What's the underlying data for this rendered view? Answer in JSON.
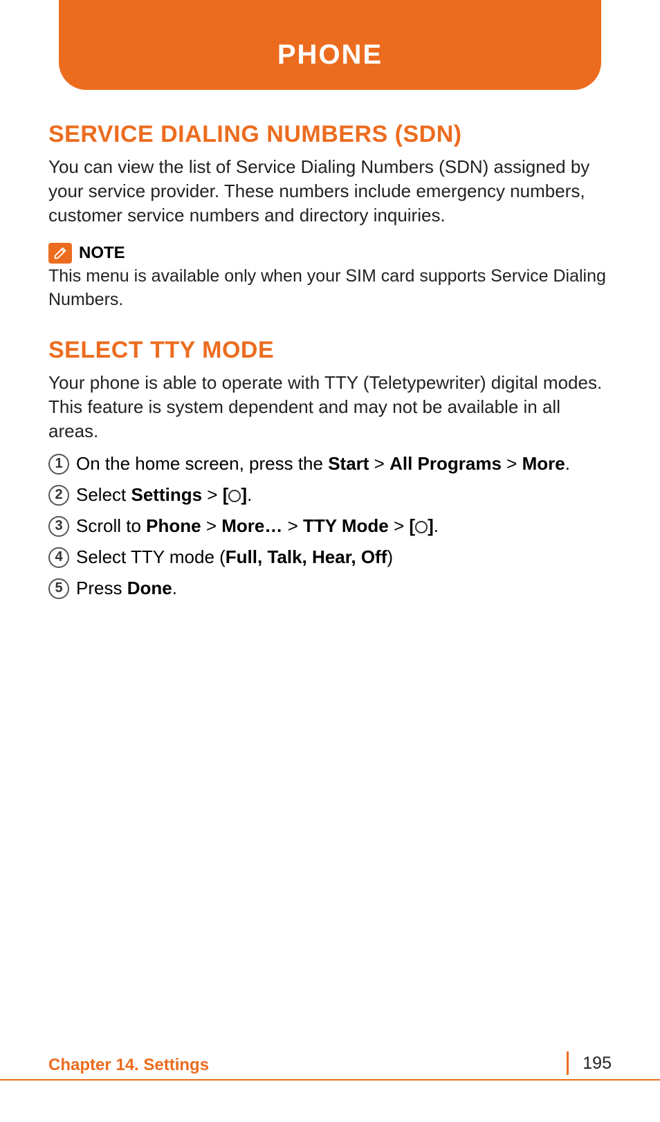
{
  "header": {
    "title": "PHONE"
  },
  "section1": {
    "heading": "SERVICE DIALING NUMBERS (SDN)",
    "body": "You can view the list of Service Dialing Numbers (SDN) assigned by your service provider. These numbers include emergency numbers, customer service numbers and directory inquiries.",
    "note_label": "NOTE",
    "note_text": "This menu is available only when your SIM card supports Service Dialing Numbers."
  },
  "section2": {
    "heading": "SELECT TTY MODE",
    "body": "Your phone is able to operate with TTY (Teletypewriter) digital modes. This feature is system dependent and may not be available in all areas.",
    "steps": [
      {
        "n": "1",
        "pre": "On the home screen, press the ",
        "b1": "Start",
        "gt1": " > ",
        "b2": "All Programs",
        "gt2": " > ",
        "b3": "More",
        "tail": ".",
        "has_circle": false,
        "tail2": ""
      },
      {
        "n": "2",
        "pre": "Select ",
        "b1": "Settings",
        "gt1": " > ",
        "b2": "[",
        "gt2": "",
        "b3": "]",
        "tail": ".",
        "has_circle": true,
        "tail2": ""
      },
      {
        "n": "3",
        "pre": "Scroll to ",
        "b1": "Phone",
        "gt1": " > ",
        "b2": "More…",
        "gt2": " > ",
        "b3": "TTY Mode",
        "tail": " > ",
        "b4": "[",
        "b5": "]",
        "has_circle": true,
        "tail2": "."
      },
      {
        "n": "4",
        "pre": "Select TTY mode (",
        "b1": "Full, Talk, Hear, Off",
        "gt1": "",
        "b2": "",
        "gt2": "",
        "b3": "",
        "tail": ")",
        "has_circle": false,
        "tail2": ""
      },
      {
        "n": "5",
        "pre": "Press ",
        "b1": "Done",
        "gt1": "",
        "b2": "",
        "gt2": "",
        "b3": "",
        "tail": ".",
        "has_circle": false,
        "tail2": ""
      }
    ]
  },
  "footer": {
    "chapter": "Chapter 14. Settings",
    "page": "195"
  }
}
